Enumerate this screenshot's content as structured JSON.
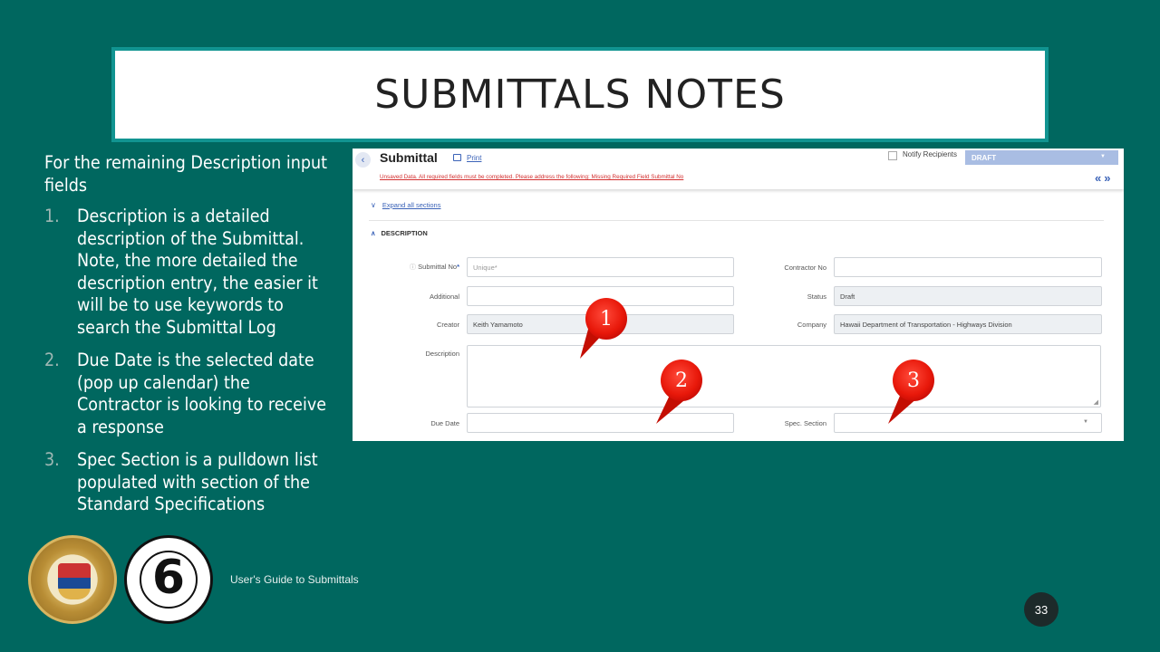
{
  "slide": {
    "title": "SUBMITTALS NOTES",
    "intro": "For the remaining Description input fields",
    "items": [
      {
        "num": "1.",
        "text": "Description is a detailed description of the Submittal. Note, the more detailed the description entry, the easier it will be to use keywords to search the Submittal Log"
      },
      {
        "num": "2.",
        "text": "Due Date is the selected date (pop up calendar) the Contractor is looking to receive a response"
      },
      {
        "num": "3.",
        "text": "Spec Section is a pulldown list populated with section of the Standard Specifications"
      }
    ],
    "footer": "User's Guide to Submittals",
    "page_number": "33"
  },
  "screenshot": {
    "title": "Submittal",
    "print_label": "Print",
    "notify_label": "Notify Recipients",
    "status_value": "DRAFT",
    "warning": "Unsaved Data. All required fields must be completed. Please address the following: Missing Required Field Submittal No",
    "collapse_icons": "«»",
    "expand_label": "Expand all sections",
    "section_label": "DESCRIPTION",
    "fields": {
      "submittal_no_label": "Submittal No",
      "submittal_no_placeholder": "Unique*",
      "contractor_no_label": "Contractor No",
      "additional_label": "Additional",
      "status_label": "Status",
      "status_value": "Draft",
      "creator_label": "Creator",
      "creator_value": "Keith Yamamoto",
      "company_label": "Company",
      "company_value": "Hawaii Department of Transportation - Highways Division",
      "description_label": "Description",
      "due_date_label": "Due Date",
      "spec_section_label": "Spec. Section"
    },
    "required_mark": "*"
  },
  "callouts": [
    "1",
    "2",
    "3"
  ],
  "colors": {
    "background": "#00675f",
    "title_border": "#119491",
    "callout": "#e8180a",
    "link": "#3b63b8",
    "warning": "#d32f2f"
  }
}
